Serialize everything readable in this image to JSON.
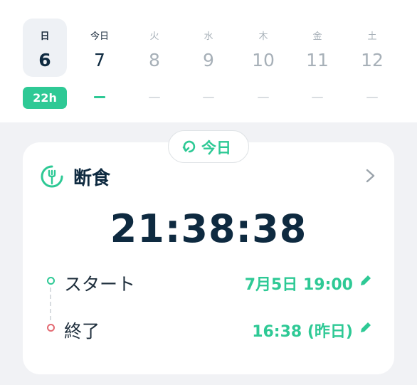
{
  "week": {
    "days": [
      {
        "name": "日",
        "num": "6"
      },
      {
        "name": "今日",
        "num": "7"
      },
      {
        "name": "火",
        "num": "8"
      },
      {
        "name": "水",
        "num": "9"
      },
      {
        "name": "木",
        "num": "10"
      },
      {
        "name": "金",
        "num": "11"
      },
      {
        "name": "土",
        "num": "12"
      }
    ],
    "selected_badge": "22h"
  },
  "card": {
    "today_button": "今日",
    "title": "断食",
    "timer": "21:38:38",
    "start": {
      "label": "スタート",
      "value": "7月5日 19:00"
    },
    "end": {
      "label": "終了",
      "value": "16:38 (昨日)"
    }
  },
  "colors": {
    "accent": "#2ec995",
    "end_dot": "#e36a72",
    "text_dark": "#0e2a40"
  }
}
